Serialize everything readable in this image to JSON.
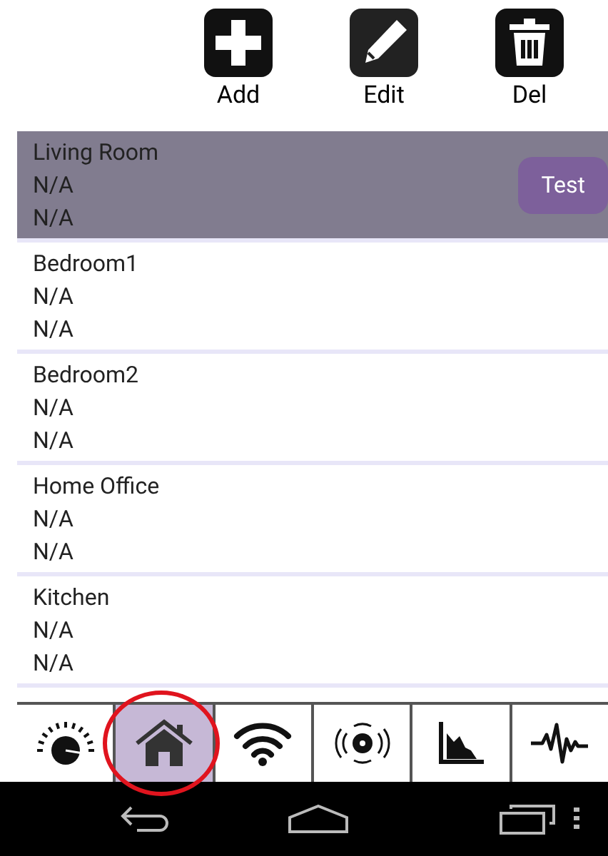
{
  "toolbar": [
    {
      "kind": "add",
      "label": "Add"
    },
    {
      "kind": "edit",
      "label": "Edit"
    },
    {
      "kind": "delete",
      "label": "Del"
    }
  ],
  "rooms": [
    {
      "name": "Living Room",
      "line_1": "N/A",
      "line_2": "N/A",
      "selected": true,
      "action": "Test"
    },
    {
      "name": "Bedroom1",
      "line_1": "N/A",
      "line_2": "N/A",
      "selected": false
    },
    {
      "name": "Bedroom2",
      "line_1": "N/A",
      "line_2": "N/A",
      "selected": false
    },
    {
      "name": "Home Office",
      "line_1": "N/A",
      "line_2": "N/A",
      "selected": false
    },
    {
      "name": "Kitchen",
      "line_1": "N/A",
      "line_2": "N/A",
      "selected": false
    }
  ],
  "tabs": [
    {
      "kind": "gauge",
      "selected": false
    },
    {
      "kind": "home",
      "selected": true,
      "circled": true
    },
    {
      "kind": "wifi",
      "selected": false
    },
    {
      "kind": "signal",
      "selected": false
    },
    {
      "kind": "chart",
      "selected": false
    },
    {
      "kind": "waveform",
      "selected": false
    }
  ],
  "nav_bar": [
    {
      "kind": "back"
    },
    {
      "kind": "home"
    },
    {
      "kind": "recents"
    },
    {
      "kind": "menu"
    }
  ]
}
